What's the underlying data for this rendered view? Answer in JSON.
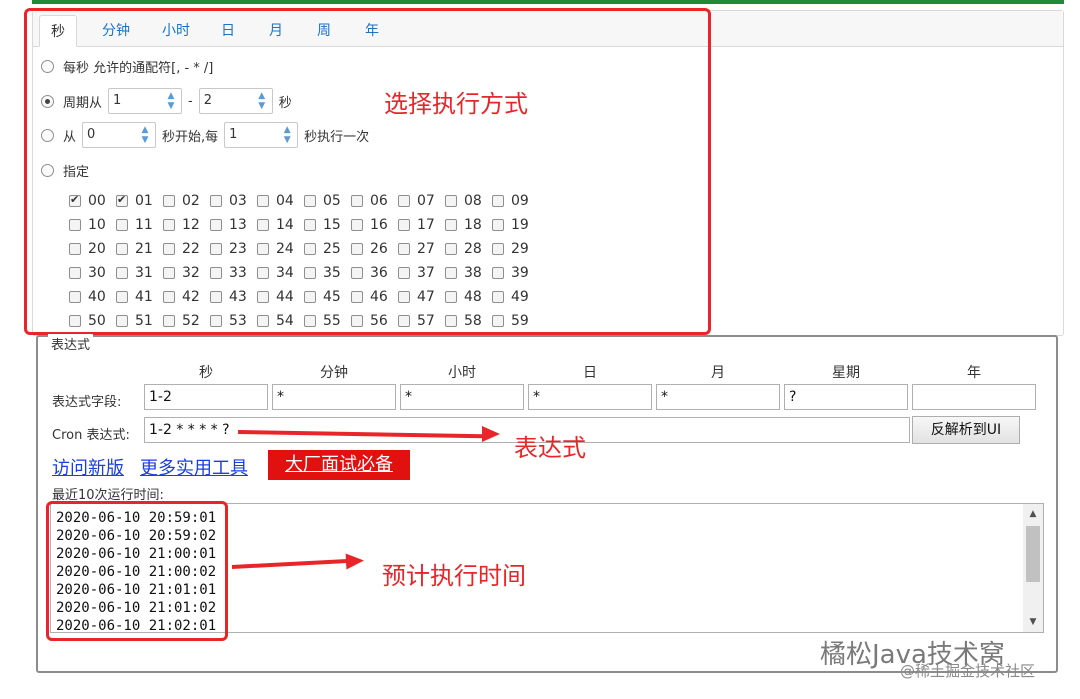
{
  "tabs": [
    "秒",
    "分钟",
    "小时",
    "日",
    "月",
    "周",
    "年"
  ],
  "options": {
    "every": "每秒 允许的通配符[, - * /]",
    "period_prefix": "周期从",
    "period_from": "1",
    "period_dash": "-",
    "period_to": "2",
    "period_suffix": "秒",
    "start_prefix": "从",
    "start_from": "0",
    "start_middle": "秒开始,每",
    "start_every": "1",
    "start_suffix": "秒执行一次",
    "specify": "指定"
  },
  "seconds": [
    "00",
    "01",
    "02",
    "03",
    "04",
    "05",
    "06",
    "07",
    "08",
    "09",
    "10",
    "11",
    "12",
    "13",
    "14",
    "15",
    "16",
    "17",
    "18",
    "19",
    "20",
    "21",
    "22",
    "23",
    "24",
    "25",
    "26",
    "27",
    "28",
    "29",
    "30",
    "31",
    "32",
    "33",
    "34",
    "35",
    "36",
    "37",
    "38",
    "39",
    "40",
    "41",
    "42",
    "43",
    "44",
    "45",
    "46",
    "47",
    "48",
    "49",
    "50",
    "51",
    "52",
    "53",
    "54",
    "55",
    "56",
    "57",
    "58",
    "59"
  ],
  "checked_seconds": [
    "00",
    "01"
  ],
  "annotations": {
    "method": "选择执行方式",
    "expression": "表达式",
    "schedule": "预计执行时间"
  },
  "expression": {
    "legend": "表达式",
    "columns": [
      "秒",
      "分钟",
      "小时",
      "日",
      "月",
      "星期",
      "年"
    ],
    "fields_label": "表达式字段:",
    "fields": [
      "1-2",
      "*",
      "*",
      "*",
      "*",
      "?",
      ""
    ],
    "cron_label": "Cron 表达式:",
    "cron_value": "1-2 * * * * ?",
    "parse_button": "反解析到UI"
  },
  "links": {
    "visit_new": "访问新版",
    "more_tools": "更多实用工具",
    "interview": "大厂面试必备"
  },
  "runs": {
    "label": "最近10次运行时间:",
    "times": [
      "2020-06-10 20:59:01",
      "2020-06-10 20:59:02",
      "2020-06-10 21:00:01",
      "2020-06-10 21:00:02",
      "2020-06-10 21:01:01",
      "2020-06-10 21:01:02",
      "2020-06-10 21:02:01"
    ]
  },
  "watermark": "橘松Java技术窝",
  "watermark_sub": "@稀土掘金技术社区",
  "colors": {
    "accent_green": "#1e8a3a",
    "annotation_red": "#e8262a",
    "link_blue": "#1a3ee0"
  }
}
